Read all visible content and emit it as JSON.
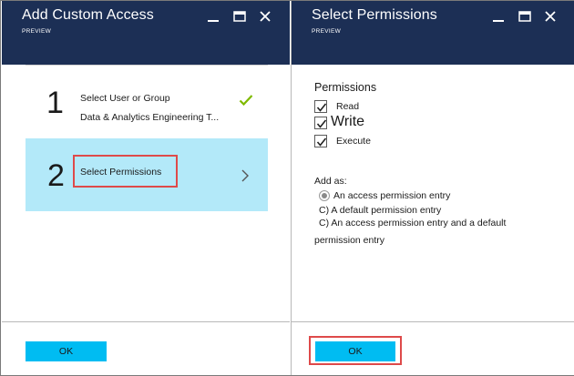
{
  "left_blade": {
    "title": "Add Custom Access",
    "subtitle": "PREVIEW",
    "steps": [
      {
        "number": "1",
        "title": "Select User or Group",
        "subtitle": "Data & Analytics Engineering T...",
        "status": "complete"
      },
      {
        "number": "2",
        "title": "Select Permissions",
        "status": "selected"
      }
    ],
    "ok_label": "OK"
  },
  "right_blade": {
    "title": "Select Permissions",
    "subtitle": "PREVIEW",
    "permissions_heading": "Permissions",
    "permissions": [
      {
        "label": "Read",
        "checked": true
      },
      {
        "label": "Write",
        "checked": true
      },
      {
        "label": "Execute",
        "checked": true
      }
    ],
    "add_as_label": "Add as:",
    "options": [
      {
        "label": "An access permission entry",
        "selected": true
      },
      {
        "label": "C) A default permission entry"
      },
      {
        "label": "C) An access permission entry and a default",
        "label_cont": "permission entry"
      }
    ],
    "ok_label": "OK"
  },
  "colors": {
    "header_bg": "#1c2f55",
    "selected_step_bg": "#b3e9f9",
    "ok_button_bg": "#00bcf2",
    "highlight_border": "#de4a4a",
    "check_green": "#7fba00"
  },
  "icons": {
    "window_controls": [
      "minimize-icon",
      "maximize-icon",
      "close-icon"
    ],
    "step_complete": "checkmark-icon",
    "step_open": "chevron-right-icon"
  }
}
